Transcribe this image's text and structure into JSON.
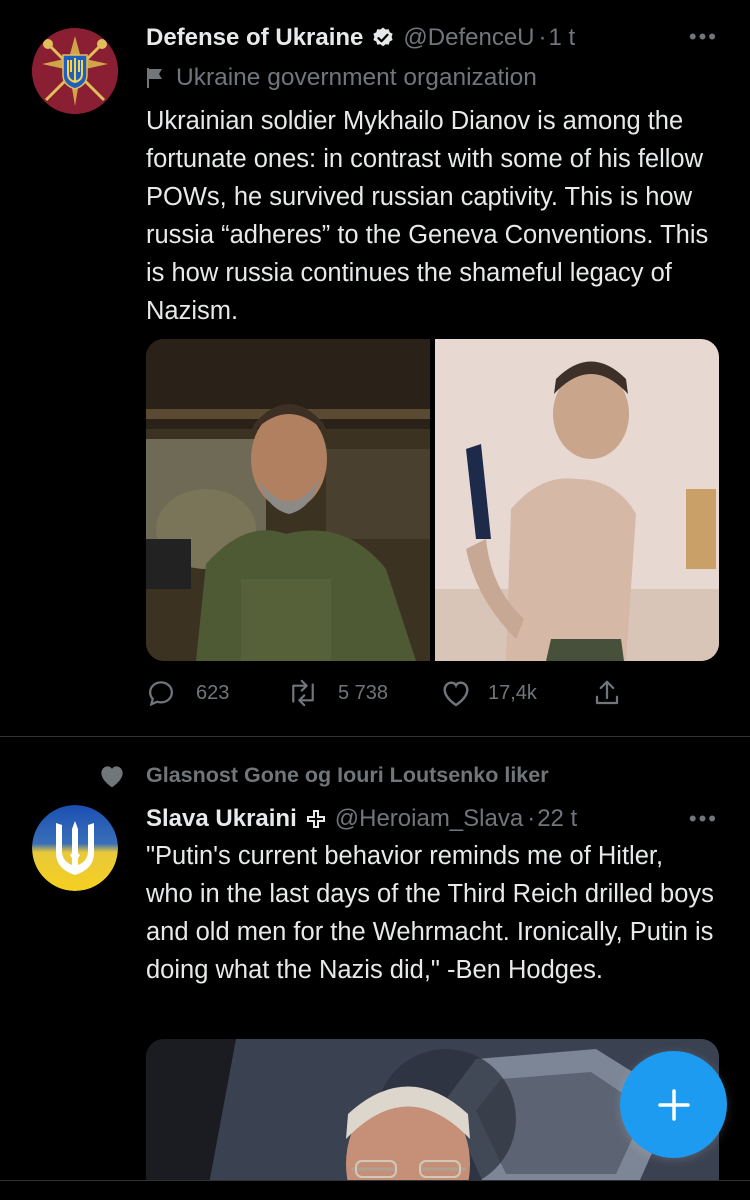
{
  "tweets": [
    {
      "author_name": "Defense of Ukraine",
      "verified": true,
      "handle": "@DefenceU",
      "time": "1 t",
      "more_label": "•••",
      "org_label": "Ukraine government organization",
      "text": "Ukrainian soldier Mykhailo Dianov is among the fortunate ones: in contrast with some of his fellow POWs, he survived russian captivity. This is how russia “adheres” to the Geneva Conventions. This is how russia continues the shameful legacy of Nazism.",
      "stats": {
        "replies": "623",
        "retweets": "5 738",
        "likes": "17,4k"
      }
    },
    {
      "social_context": "Glasnost Gone og Iouri Loutsenko liker",
      "author_name": "Slava Ukraini",
      "handle": "@Heroiam_Slava",
      "time": "22 t",
      "more_label": "•••",
      "text": "\"Putin's current behavior reminds me of Hitler, who in the last days of the Third Reich drilled boys and old men for the Wehrmacht. Ironically, Putin is doing what the Nazis did,\" -Ben Hodges."
    }
  ],
  "fab": {
    "icon": "plus-icon"
  },
  "colors": {
    "background": "#000000",
    "primary_text": "#e7e9ea",
    "secondary_text": "#71767b",
    "accent": "#1d9bf0",
    "divider": "#2f3336"
  }
}
